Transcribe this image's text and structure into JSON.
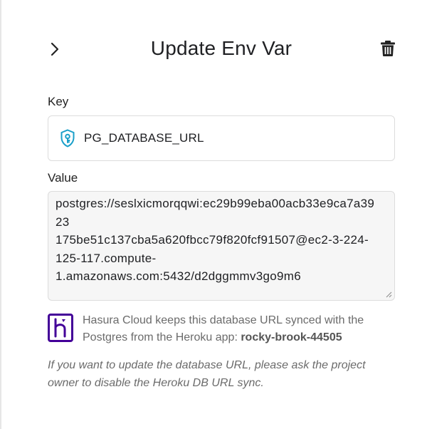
{
  "header": {
    "title": "Update Env Var"
  },
  "form": {
    "key_label": "Key",
    "key_value": "PG_DATABASE_URL",
    "value_label": "Value",
    "value_lines": [
      "postgres://seslxicmorqqwi:ec29b99eba00acb33e9ca7a3923",
      "175be51c137cba5a620fbcc79f820fcf91507@ec2-3-224-",
      "125-117.compute-",
      "1.amazonaws.com:5432/d2dggmmv3go9m6"
    ]
  },
  "info": {
    "text_before": "Hasura Cloud keeps this database URL synced with the Postgres from the Heroku app: ",
    "app_name": "rocky-brook-44505"
  },
  "note": {
    "text": "If you want to update the database URL, please ask the project owner to disable the Heroku DB URL sync."
  },
  "colors": {
    "shield_accent": "#1a9fc9",
    "heroku_purple": "#430098"
  },
  "icons": {
    "back": "chevron-right-icon",
    "delete": "trash-icon",
    "key": "shield-key-icon",
    "info": "heroku-logo-icon"
  }
}
